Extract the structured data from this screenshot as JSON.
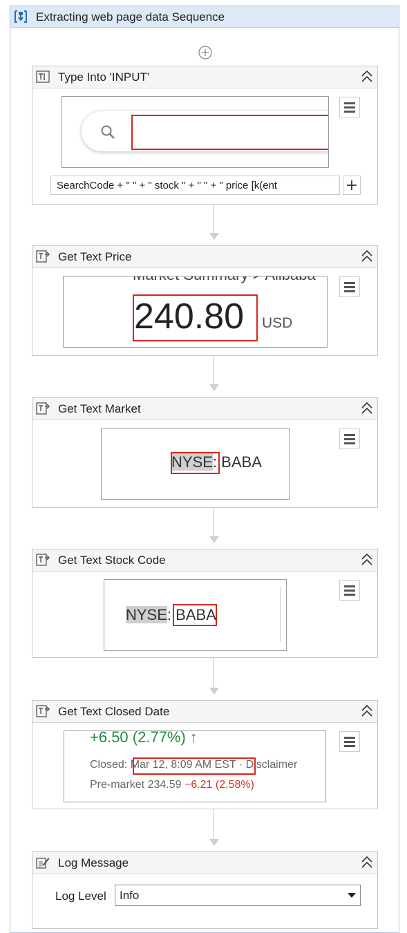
{
  "sequence": {
    "title": "Extracting web page data Sequence"
  },
  "activities": {
    "type_into": {
      "title": "Type Into 'INPUT'",
      "expression": "SearchCode + \"  \" + \"  stock \" + \" \" + \" price   [k(ent"
    },
    "get_text_price": {
      "title": "Get Text Price",
      "preview_header": "Market Summary > Alibaba",
      "price": "240.80",
      "currency": "USD"
    },
    "get_text_market": {
      "title": "Get Text Market",
      "exchange": "NYSE",
      "separator": ":",
      "code": "BABA"
    },
    "get_text_stock_code": {
      "title": "Get Text Stock Code",
      "exchange": "NYSE",
      "separator": ":",
      "code": "BABA"
    },
    "get_text_closed_date": {
      "title": "Get Text Closed Date",
      "change_line": "+6.50 (2.77%) ↑",
      "closed_label": "Closed:",
      "closed_value": "Mar 12, 8:09 AM EST",
      "disclaimer": "· Disclaimer",
      "premarket_label": "Pre-market 234.59",
      "premarket_change": "−6.21 (2.58%)"
    },
    "log_message": {
      "title": "Log Message",
      "log_level_label": "Log Level",
      "log_level_value": "Info"
    }
  },
  "colors": {
    "selection_box": "#d9261c",
    "sequence_header": "#dde9f7",
    "positive": "#1e8e3e",
    "negative": "#d93025"
  },
  "icons": [
    "sequence-icon",
    "add-activity-icon",
    "type-into-icon",
    "get-text-icon",
    "collapse-icon",
    "menu-icon",
    "search-icon",
    "plus-icon",
    "log-message-icon",
    "dropdown-arrow-icon"
  ]
}
